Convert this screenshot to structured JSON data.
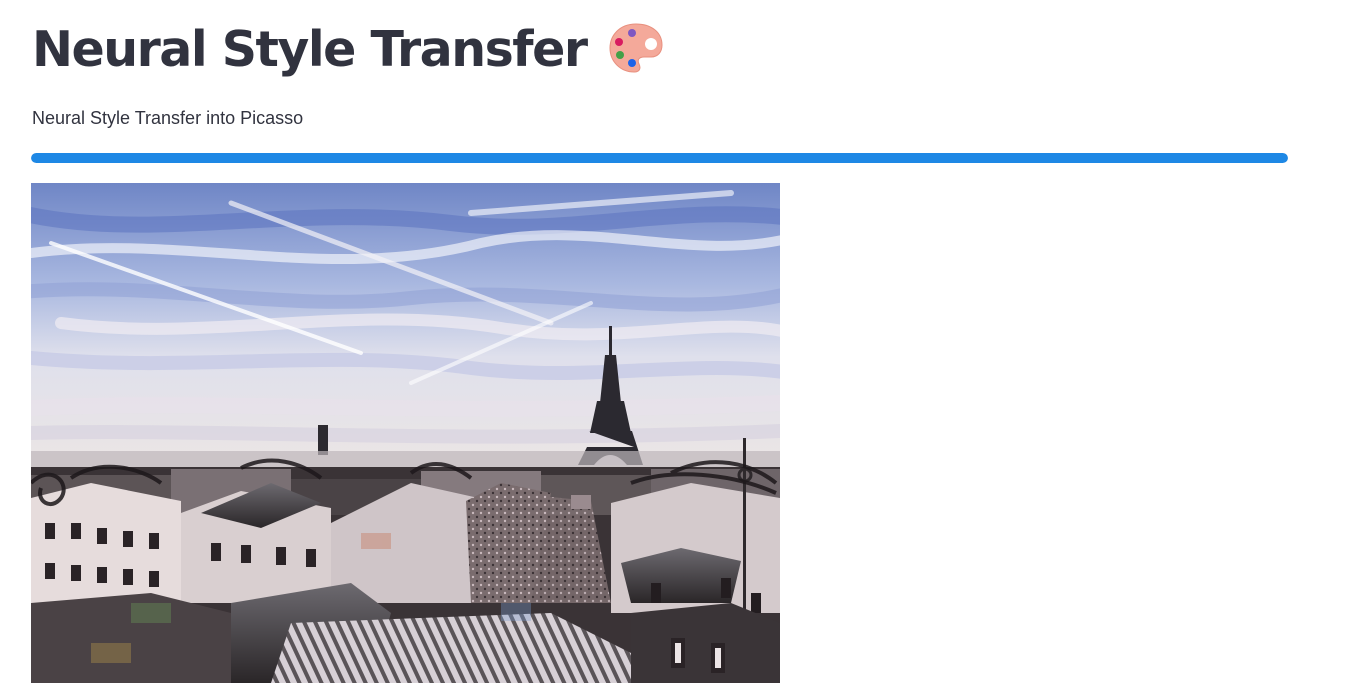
{
  "page": {
    "title": "Neural Style Transfer",
    "subtitle": "Neural Style Transfer into Picasso"
  },
  "progress": {
    "fraction": 1.0,
    "color": "#1e88e5"
  },
  "title_icon": "artist-palette-icon",
  "image": {
    "kind": "stylized-photo",
    "subject_icon": "paris-rooftops-eiffel-tower-stylized-image"
  }
}
